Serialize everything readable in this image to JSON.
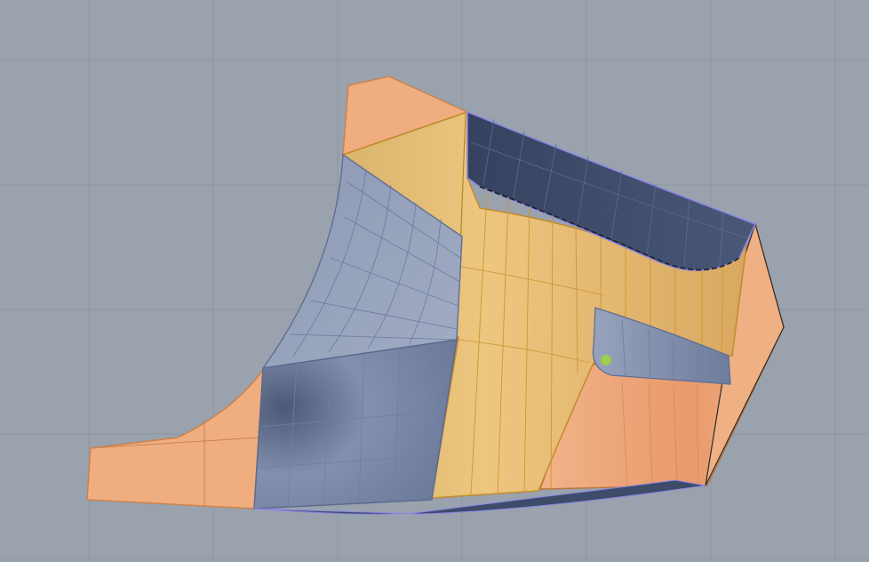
{
  "viewport": {
    "label": "",
    "background_color": "#9aa2ad",
    "grid_color": "#8e96a1"
  },
  "colors": {
    "orange_surface": "#f0ad80",
    "orange_edge": "#c9834f",
    "yellow_surface": "#e8c07a",
    "yellow_edge": "#d49a2e",
    "blue_surface": "#8f9bb6",
    "blue_dark": "#3d4c6c",
    "blue_edge": "#5f6f95",
    "selection_edge": "#8a86e6",
    "control_point": "#9ccf4b"
  },
  "objects": [
    {
      "name": "orange-patch-top-left"
    },
    {
      "name": "orange-patch-bottom-left"
    },
    {
      "name": "orange-patch-right"
    },
    {
      "name": "yellow-patch-center"
    },
    {
      "name": "blue-patch-upper-left"
    },
    {
      "name": "blue-patch-lower-left"
    },
    {
      "name": "blue-patch-top-dark"
    },
    {
      "name": "blue-patch-small-right"
    },
    {
      "name": "control-point"
    }
  ]
}
